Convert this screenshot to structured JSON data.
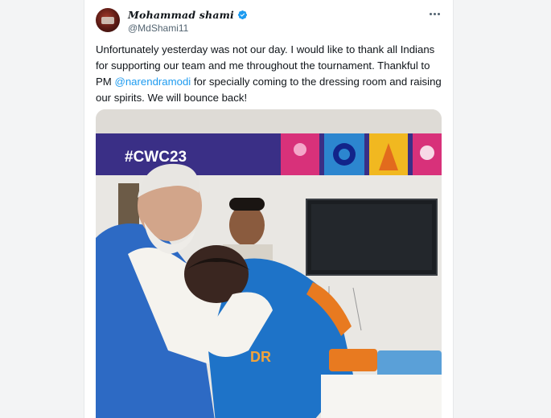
{
  "tweet": {
    "author": {
      "display_name": "Mohammad shami",
      "handle": "@MdShami11",
      "verified": true,
      "avatar_icon": "profile-avatar"
    },
    "text_before_mention": "Unfortunately yesterday was not our day. I would like to thank all Indians for supporting our team and me throughout the tournament. Thankful to PM ",
    "mention": "@narendramodi",
    "text_after_mention": " for specially coming to the dressing room and raising our spirits. We will bounce back!",
    "more_icon": "more-horizontal-icon",
    "media": {
      "banner_text": "#CWC23",
      "jersey_text": "DR"
    }
  },
  "colors": {
    "mention": "#1d9bf0",
    "verified": "#1d9bf0",
    "banner": "#3a2f86",
    "jersey": "#1e73c8"
  }
}
